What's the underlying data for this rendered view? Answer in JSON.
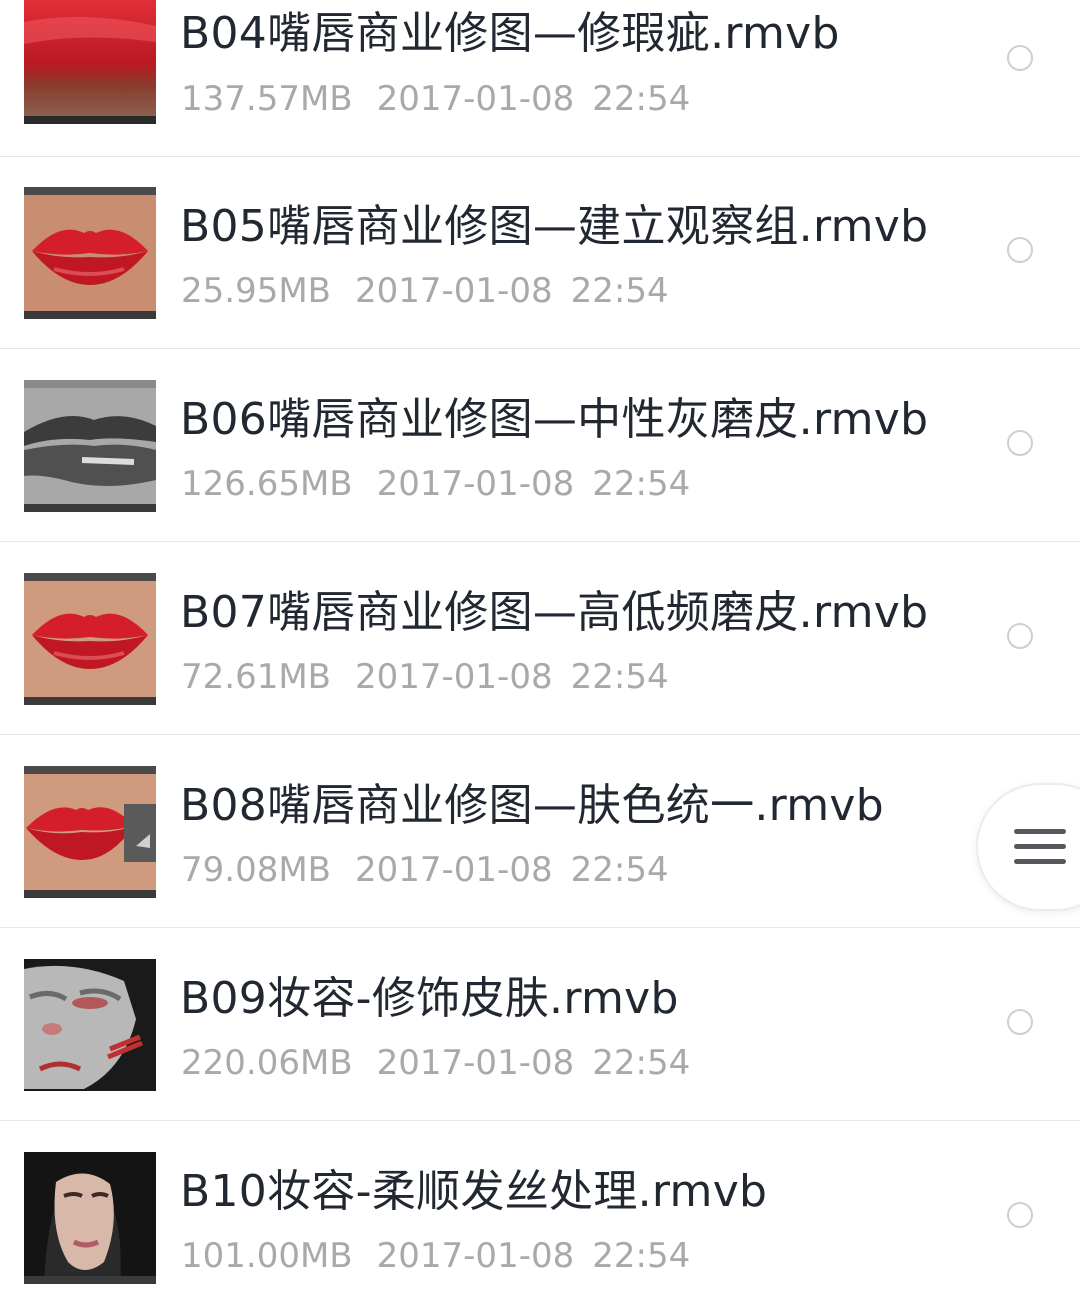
{
  "files": [
    {
      "name": "B04嘴唇商业修图—修瑕疵.rmvb",
      "size": "137.57MB",
      "date": "2017-01-08",
      "time": "22:54",
      "thumbnail": "lips-closeup"
    },
    {
      "name": "B05嘴唇商业修图—建立观察组.rmvb",
      "size": "25.95MB",
      "date": "2017-01-08",
      "time": "22:54",
      "thumbnail": "red-lips"
    },
    {
      "name": "B06嘴唇商业修图—中性灰磨皮.rmvb",
      "size": "126.65MB",
      "date": "2017-01-08",
      "time": "22:54",
      "thumbnail": "gray-lips"
    },
    {
      "name": "B07嘴唇商业修图—高低频磨皮.rmvb",
      "size": "72.61MB",
      "date": "2017-01-08",
      "time": "22:54",
      "thumbnail": "red-lips"
    },
    {
      "name": "B08嘴唇商业修图—肤色统一.rmvb",
      "size": "79.08MB",
      "date": "2017-01-08",
      "time": "22:54",
      "thumbnail": "red-lips-panel"
    },
    {
      "name": "B09妆容-修饰皮肤.rmvb",
      "size": "220.06MB",
      "date": "2017-01-08",
      "time": "22:54",
      "thumbnail": "makeup-face"
    },
    {
      "name": "B10妆容-柔顺发丝处理.rmvb",
      "size": "101.00MB",
      "date": "2017-01-08",
      "time": "22:54",
      "thumbnail": "portrait-hair"
    }
  ],
  "floating_menu": {
    "icon": "menu-icon"
  },
  "colors": {
    "title_text": "#222831",
    "meta_text": "#a9a9a9",
    "divider": "#e6e6e6",
    "radio_border": "#cfcfcf",
    "lip_red": "#d41f2a"
  }
}
